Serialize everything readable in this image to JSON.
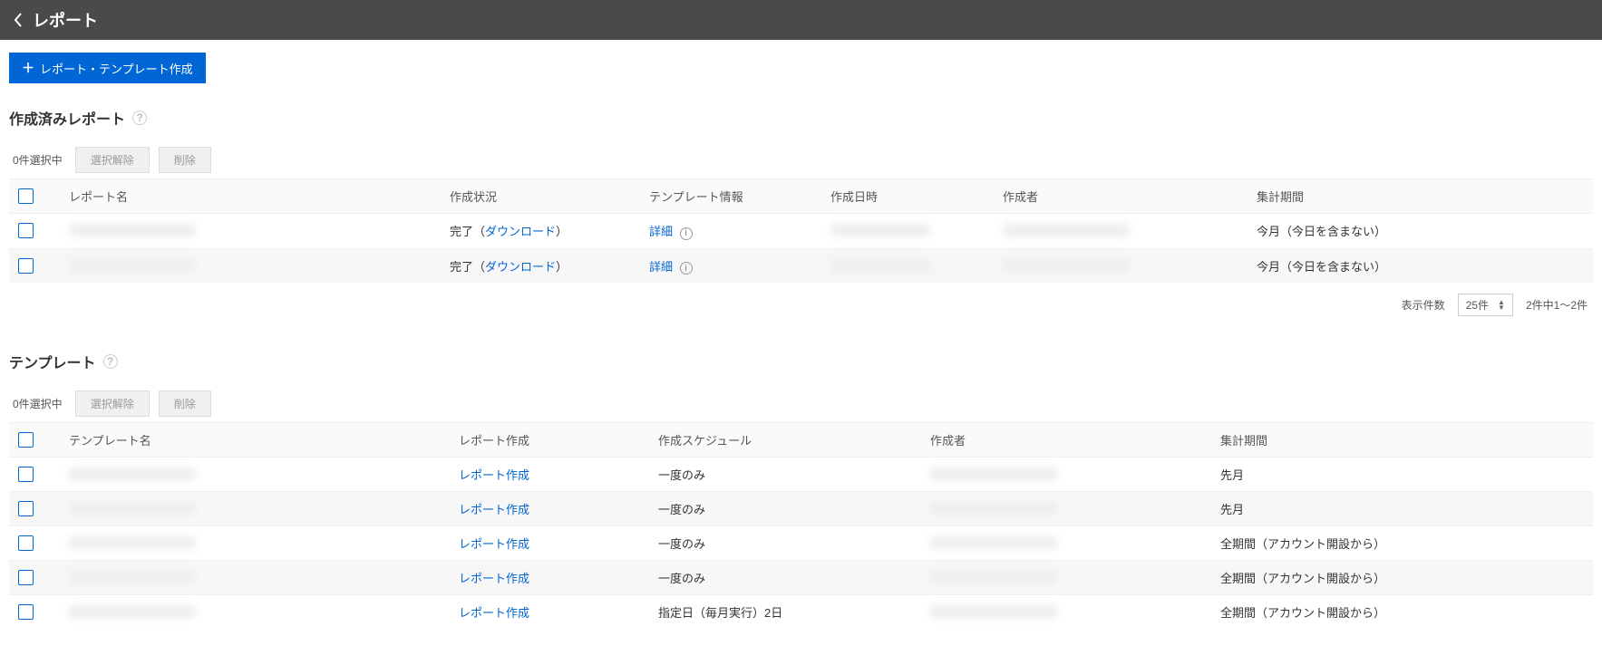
{
  "header": {
    "title": "レポート"
  },
  "create_button": "レポート・テンプレート作成",
  "reports": {
    "section_title": "作成済みレポート",
    "selected_count": "0件選択中",
    "deselect": "選択解除",
    "delete": "削除",
    "columns": {
      "name": "レポート名",
      "status": "作成状況",
      "template_info": "テンプレート情報",
      "created_at": "作成日時",
      "creator": "作成者",
      "period": "集計期間"
    },
    "rows": [
      {
        "status_prefix": "完了（",
        "download": "ダウンロード",
        "status_suffix": "）",
        "detail": "詳細",
        "period": "今月（今日を含まない）"
      },
      {
        "status_prefix": "完了（",
        "download": "ダウンロード",
        "status_suffix": "）",
        "detail": "詳細",
        "period": "今月（今日を含まない）"
      }
    ],
    "pager": {
      "label": "表示件数",
      "size": "25件",
      "range": "2件中1～2件"
    }
  },
  "templates": {
    "section_title": "テンプレート",
    "selected_count": "0件選択中",
    "deselect": "選択解除",
    "delete": "削除",
    "columns": {
      "name": "テンプレート名",
      "create": "レポート作成",
      "schedule": "作成スケジュール",
      "creator": "作成者",
      "period": "集計期間"
    },
    "rows": [
      {
        "create": "レポート作成",
        "schedule": "一度のみ",
        "period": "先月"
      },
      {
        "create": "レポート作成",
        "schedule": "一度のみ",
        "period": "先月"
      },
      {
        "create": "レポート作成",
        "schedule": "一度のみ",
        "period": "全期間（アカウント開設から）"
      },
      {
        "create": "レポート作成",
        "schedule": "一度のみ",
        "period": "全期間（アカウント開設から）"
      },
      {
        "create": "レポート作成",
        "schedule": "指定日（毎月実行）2日",
        "period": "全期間（アカウント開設から）"
      }
    ]
  }
}
